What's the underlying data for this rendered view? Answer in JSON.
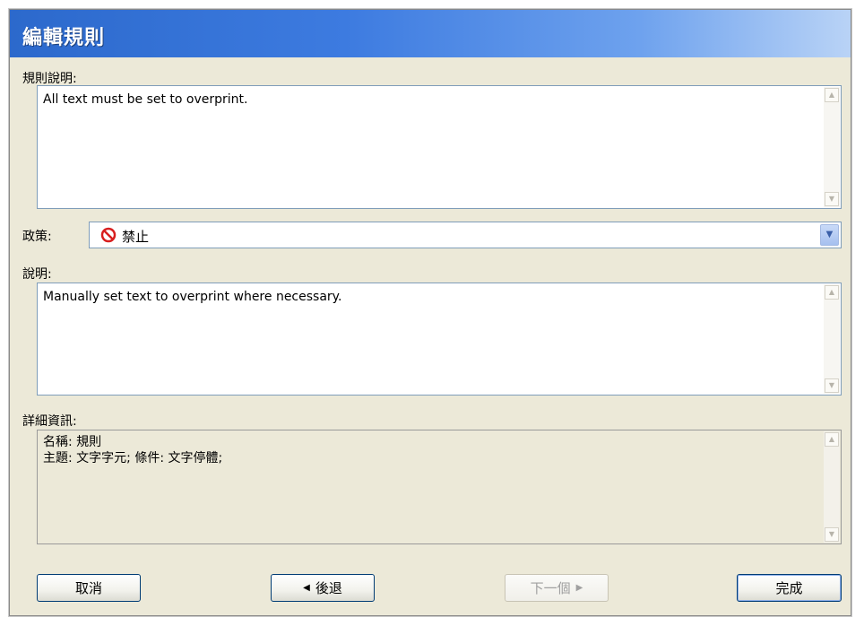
{
  "window": {
    "title": "編輯規則"
  },
  "rule_description": {
    "label": "規則說明:",
    "value": "All text must be set to overprint."
  },
  "policy": {
    "label": "政策:",
    "selected": "禁止",
    "icon": "prohibited-icon",
    "icon_color": "#d81e1e"
  },
  "explanation": {
    "label": "說明:",
    "value": "Manually set text to overprint where necessary."
  },
  "details": {
    "label": "詳細資訊:",
    "lines": [
      "名稱: 規則",
      "主題: 文字字元; 條件: 文字停體;"
    ]
  },
  "buttons": {
    "cancel": "取消",
    "back": "後退",
    "back_arrow": "◀",
    "next": "下一個",
    "next_arrow": "▶",
    "finish": "完成"
  }
}
